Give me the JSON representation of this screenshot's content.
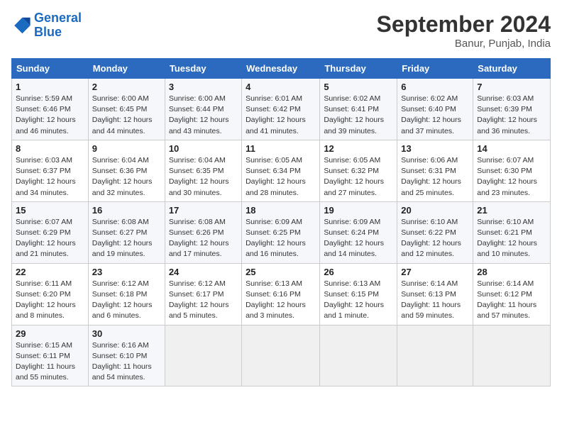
{
  "logo": {
    "line1": "General",
    "line2": "Blue"
  },
  "title": "September 2024",
  "location": "Banur, Punjab, India",
  "headers": [
    "Sunday",
    "Monday",
    "Tuesday",
    "Wednesday",
    "Thursday",
    "Friday",
    "Saturday"
  ],
  "weeks": [
    [
      {
        "day": "1",
        "info": "Sunrise: 5:59 AM\nSunset: 6:46 PM\nDaylight: 12 hours\nand 46 minutes."
      },
      {
        "day": "2",
        "info": "Sunrise: 6:00 AM\nSunset: 6:45 PM\nDaylight: 12 hours\nand 44 minutes."
      },
      {
        "day": "3",
        "info": "Sunrise: 6:00 AM\nSunset: 6:44 PM\nDaylight: 12 hours\nand 43 minutes."
      },
      {
        "day": "4",
        "info": "Sunrise: 6:01 AM\nSunset: 6:42 PM\nDaylight: 12 hours\nand 41 minutes."
      },
      {
        "day": "5",
        "info": "Sunrise: 6:02 AM\nSunset: 6:41 PM\nDaylight: 12 hours\nand 39 minutes."
      },
      {
        "day": "6",
        "info": "Sunrise: 6:02 AM\nSunset: 6:40 PM\nDaylight: 12 hours\nand 37 minutes."
      },
      {
        "day": "7",
        "info": "Sunrise: 6:03 AM\nSunset: 6:39 PM\nDaylight: 12 hours\nand 36 minutes."
      }
    ],
    [
      {
        "day": "8",
        "info": "Sunrise: 6:03 AM\nSunset: 6:37 PM\nDaylight: 12 hours\nand 34 minutes."
      },
      {
        "day": "9",
        "info": "Sunrise: 6:04 AM\nSunset: 6:36 PM\nDaylight: 12 hours\nand 32 minutes."
      },
      {
        "day": "10",
        "info": "Sunrise: 6:04 AM\nSunset: 6:35 PM\nDaylight: 12 hours\nand 30 minutes."
      },
      {
        "day": "11",
        "info": "Sunrise: 6:05 AM\nSunset: 6:34 PM\nDaylight: 12 hours\nand 28 minutes."
      },
      {
        "day": "12",
        "info": "Sunrise: 6:05 AM\nSunset: 6:32 PM\nDaylight: 12 hours\nand 27 minutes."
      },
      {
        "day": "13",
        "info": "Sunrise: 6:06 AM\nSunset: 6:31 PM\nDaylight: 12 hours\nand 25 minutes."
      },
      {
        "day": "14",
        "info": "Sunrise: 6:07 AM\nSunset: 6:30 PM\nDaylight: 12 hours\nand 23 minutes."
      }
    ],
    [
      {
        "day": "15",
        "info": "Sunrise: 6:07 AM\nSunset: 6:29 PM\nDaylight: 12 hours\nand 21 minutes."
      },
      {
        "day": "16",
        "info": "Sunrise: 6:08 AM\nSunset: 6:27 PM\nDaylight: 12 hours\nand 19 minutes."
      },
      {
        "day": "17",
        "info": "Sunrise: 6:08 AM\nSunset: 6:26 PM\nDaylight: 12 hours\nand 17 minutes."
      },
      {
        "day": "18",
        "info": "Sunrise: 6:09 AM\nSunset: 6:25 PM\nDaylight: 12 hours\nand 16 minutes."
      },
      {
        "day": "19",
        "info": "Sunrise: 6:09 AM\nSunset: 6:24 PM\nDaylight: 12 hours\nand 14 minutes."
      },
      {
        "day": "20",
        "info": "Sunrise: 6:10 AM\nSunset: 6:22 PM\nDaylight: 12 hours\nand 12 minutes."
      },
      {
        "day": "21",
        "info": "Sunrise: 6:10 AM\nSunset: 6:21 PM\nDaylight: 12 hours\nand 10 minutes."
      }
    ],
    [
      {
        "day": "22",
        "info": "Sunrise: 6:11 AM\nSunset: 6:20 PM\nDaylight: 12 hours\nand 8 minutes."
      },
      {
        "day": "23",
        "info": "Sunrise: 6:12 AM\nSunset: 6:18 PM\nDaylight: 12 hours\nand 6 minutes."
      },
      {
        "day": "24",
        "info": "Sunrise: 6:12 AM\nSunset: 6:17 PM\nDaylight: 12 hours\nand 5 minutes."
      },
      {
        "day": "25",
        "info": "Sunrise: 6:13 AM\nSunset: 6:16 PM\nDaylight: 12 hours\nand 3 minutes."
      },
      {
        "day": "26",
        "info": "Sunrise: 6:13 AM\nSunset: 6:15 PM\nDaylight: 12 hours\nand 1 minute."
      },
      {
        "day": "27",
        "info": "Sunrise: 6:14 AM\nSunset: 6:13 PM\nDaylight: 11 hours\nand 59 minutes."
      },
      {
        "day": "28",
        "info": "Sunrise: 6:14 AM\nSunset: 6:12 PM\nDaylight: 11 hours\nand 57 minutes."
      }
    ],
    [
      {
        "day": "29",
        "info": "Sunrise: 6:15 AM\nSunset: 6:11 PM\nDaylight: 11 hours\nand 55 minutes."
      },
      {
        "day": "30",
        "info": "Sunrise: 6:16 AM\nSunset: 6:10 PM\nDaylight: 11 hours\nand 54 minutes."
      },
      {
        "day": "",
        "info": ""
      },
      {
        "day": "",
        "info": ""
      },
      {
        "day": "",
        "info": ""
      },
      {
        "day": "",
        "info": ""
      },
      {
        "day": "",
        "info": ""
      }
    ]
  ]
}
